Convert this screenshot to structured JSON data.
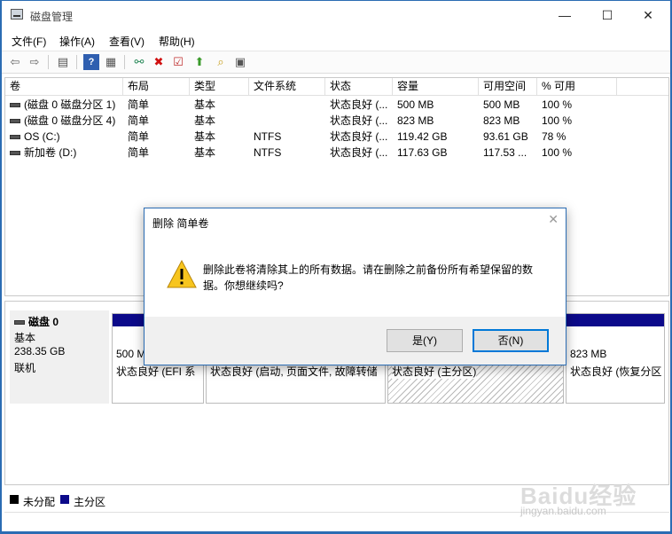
{
  "window": {
    "title": "磁盘管理",
    "minimize": "—",
    "maximize": "☐",
    "close": "✕"
  },
  "menu": [
    "文件(F)",
    "操作(A)",
    "查看(V)",
    "帮助(H)"
  ],
  "toolbar": {
    "icons": [
      "back-icon",
      "forward-icon",
      "properties-icon",
      "help-icon",
      "console-icon",
      "connect-icon",
      "delete-icon",
      "check-icon",
      "import-icon",
      "search-icon",
      "list-icon"
    ]
  },
  "volumes": {
    "headers": [
      "卷",
      "布局",
      "类型",
      "文件系统",
      "状态",
      "容量",
      "可用空间",
      "% 可用"
    ],
    "rows": [
      [
        "(磁盘 0 磁盘分区 1)",
        "简单",
        "基本",
        "",
        "状态良好 (...",
        "500 MB",
        "500 MB",
        "100 %"
      ],
      [
        "(磁盘 0 磁盘分区 4)",
        "简单",
        "基本",
        "",
        "状态良好 (...",
        "823 MB",
        "823 MB",
        "100 %"
      ],
      [
        "OS (C:)",
        "简单",
        "基本",
        "NTFS",
        "状态良好 (...",
        "119.42 GB",
        "93.61 GB",
        "78 %"
      ],
      [
        "新加卷 (D:)",
        "简单",
        "基本",
        "NTFS",
        "状态良好 (...",
        "117.63 GB",
        "117.53 ...",
        "100 %"
      ]
    ]
  },
  "disk": {
    "name": "磁盘 0",
    "type": "基本",
    "size": "238.35 GB",
    "status": "联机",
    "partitions": [
      {
        "size": "500 M",
        "status": "状态良好 (EFI 系"
      },
      {
        "size": "",
        "status": "状态良好 (启动, 页面文件, 故障转储"
      },
      {
        "size": "",
        "status": "状态良好 (主分区)"
      },
      {
        "size": "823 MB",
        "status": "状态良好 (恢复分区"
      }
    ]
  },
  "legend": [
    {
      "label": "未分配",
      "color": "#000000"
    },
    {
      "label": "主分区",
      "color": "#0c0a8a"
    }
  ],
  "dialog": {
    "title": "删除 简单卷",
    "message": "删除此卷将清除其上的所有数据。请在删除之前备份所有希望保留的数据。你想继续吗?",
    "yes": "是(Y)",
    "no": "否(N)",
    "close": "✕"
  },
  "watermark": {
    "main": "Baidu经验",
    "sub": "jingyan.baidu.com"
  }
}
